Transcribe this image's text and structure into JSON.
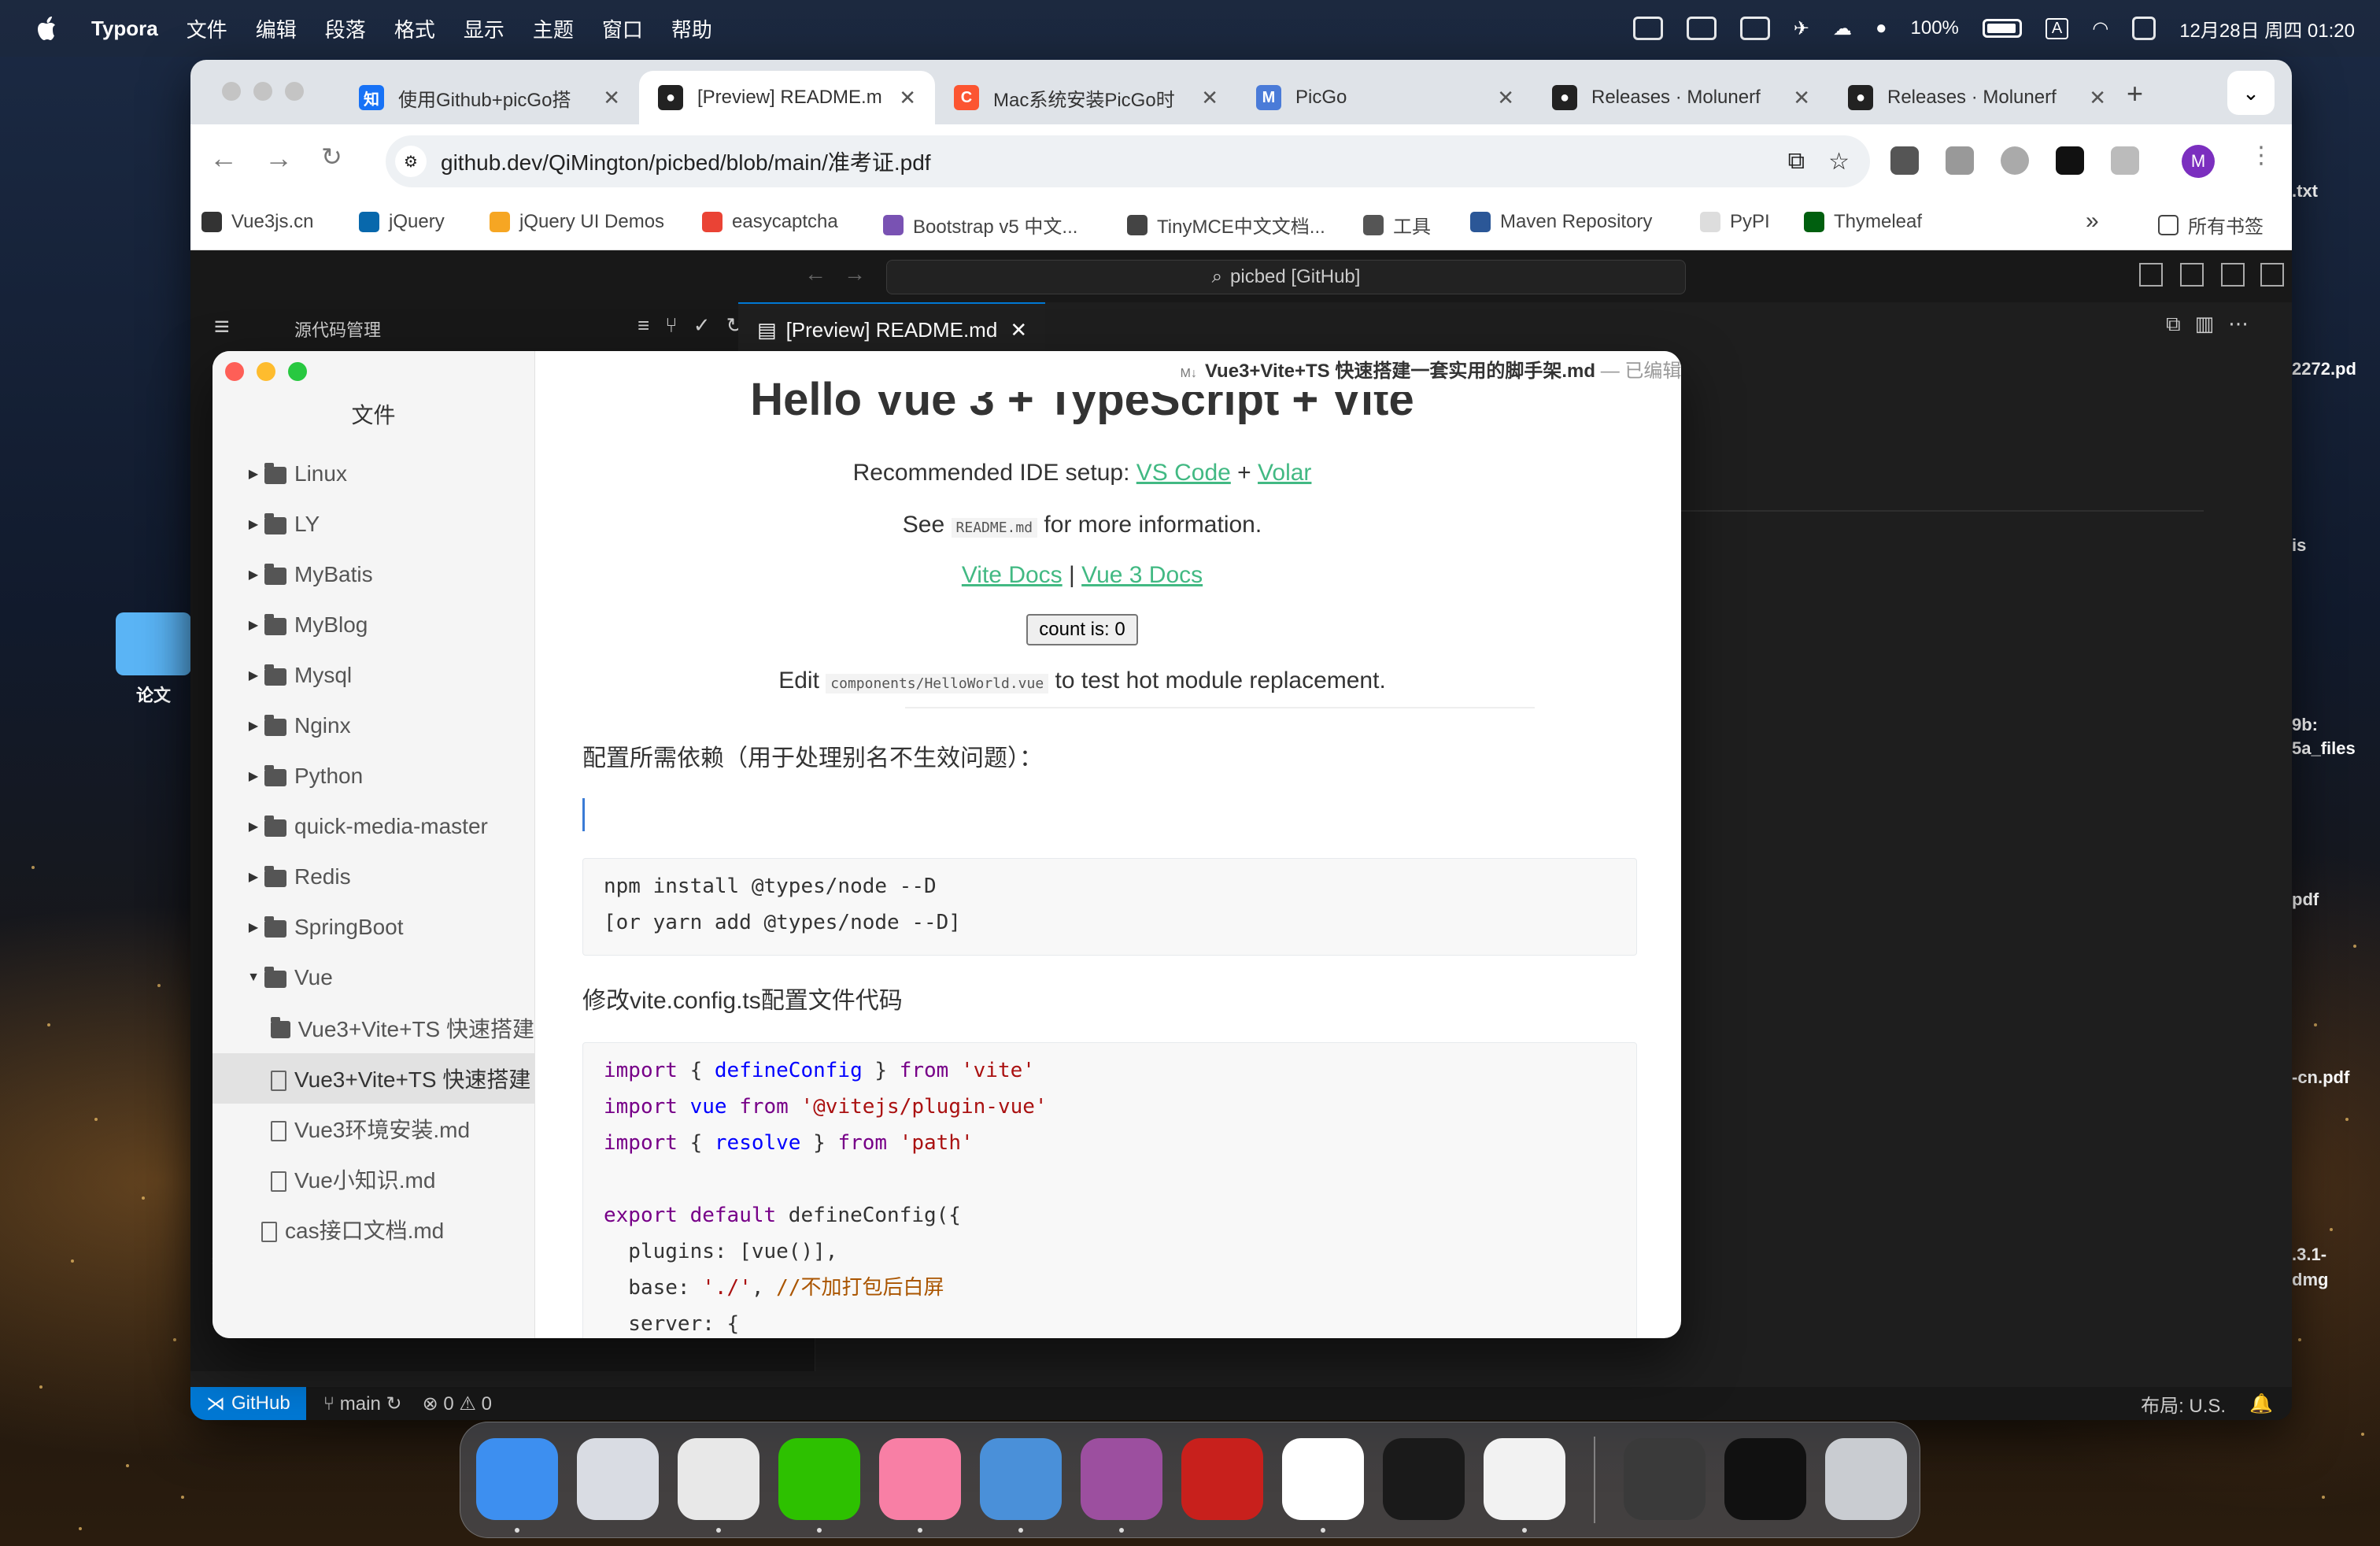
{
  "menubar": {
    "app": "Typora",
    "items": [
      "文件",
      "编辑",
      "段落",
      "格式",
      "显示",
      "主题",
      "窗口",
      "帮助"
    ],
    "battery": "100%",
    "input": "A",
    "datetime": "12月28日 周四 01:20"
  },
  "desktop": {
    "folder_label": "论文",
    "right_labels": [
      ".txt",
      "2272.pd",
      "is",
      "9b:",
      "5a_files",
      "pdf",
      "-cn.pdf",
      ".3.1-",
      "dmg"
    ]
  },
  "browser": {
    "tabs": [
      {
        "title": "使用Github+picGo搭",
        "icon": "zhihu-icon",
        "color": "#1772f6",
        "glyph": "知"
      },
      {
        "title": "[Preview] README.m",
        "icon": "github-icon",
        "color": "#222222",
        "glyph": "●"
      },
      {
        "title": "Mac系统安装PicGo时",
        "icon": "csdn-icon",
        "color": "#fc5531",
        "glyph": "C"
      },
      {
        "title": "PicGo",
        "icon": "picgo-icon",
        "color": "#4a7bd8",
        "glyph": "M"
      },
      {
        "title": "Releases · Molunerf",
        "icon": "github-icon",
        "color": "#222222",
        "glyph": "●"
      },
      {
        "title": "Releases · Molunerf",
        "icon": "github-icon",
        "color": "#222222",
        "glyph": "●"
      }
    ],
    "url": "github.dev/QiMington/picbed/blob/main/准考证.pdf",
    "profile_initial": "M",
    "bookmarks": [
      {
        "label": "Vue3js.cn",
        "color": "#333333"
      },
      {
        "label": "jQuery",
        "color": "#0868ac"
      },
      {
        "label": "jQuery UI Demos",
        "color": "#f6a623"
      },
      {
        "label": "easycaptcha",
        "color": "#ea4335"
      },
      {
        "label": "Bootstrap v5 中文...",
        "color": "#7952b3"
      },
      {
        "label": "TinyMCE中文文档...",
        "color": "#444444"
      },
      {
        "label": "工具",
        "color": "#555555"
      },
      {
        "label": "Maven Repository",
        "color": "#2b5797"
      },
      {
        "label": "PyPI",
        "color": "#dddddd"
      },
      {
        "label": "Thymeleaf",
        "color": "#005f0f"
      }
    ],
    "more": "»",
    "all_bookmarks": "所有书签"
  },
  "vscode": {
    "command_center": "picbed [GitHub]",
    "sidebar_title": "源代码管理",
    "editor_tab": "[Preview] README.md",
    "status": {
      "remote": "GitHub",
      "branch": "main",
      "problems": "0",
      "warnings": "0",
      "layout": "布局: U.S."
    }
  },
  "typora": {
    "window_title": "Vue3+Vite+TS 快速搭建一套实用的脚手架.md",
    "edited": "— 已编辑",
    "sidebar_header": "文件",
    "tree": [
      {
        "label": "Linux",
        "type": "folder",
        "level": 0,
        "expanded": false
      },
      {
        "label": "LY",
        "type": "folder",
        "level": 0,
        "expanded": false
      },
      {
        "label": "MyBatis",
        "type": "folder",
        "level": 0,
        "expanded": false
      },
      {
        "label": "MyBlog",
        "type": "folder",
        "level": 0,
        "expanded": false
      },
      {
        "label": "Mysql",
        "type": "folder",
        "level": 0,
        "expanded": false
      },
      {
        "label": "Nginx",
        "type": "folder",
        "level": 0,
        "expanded": false
      },
      {
        "label": "Python",
        "type": "folder",
        "level": 0,
        "expanded": false
      },
      {
        "label": "quick-media-master",
        "type": "folder",
        "level": 0,
        "expanded": false
      },
      {
        "label": "Redis",
        "type": "folder",
        "level": 0,
        "expanded": false
      },
      {
        "label": "SpringBoot",
        "type": "folder",
        "level": 0,
        "expanded": false
      },
      {
        "label": "Vue",
        "type": "folder",
        "level": 0,
        "expanded": true
      },
      {
        "label": "Vue3+Vite+TS 快速搭建",
        "type": "folder",
        "level": 1,
        "expanded": false
      },
      {
        "label": "Vue3+Vite+TS 快速搭建",
        "type": "file",
        "level": 1,
        "selected": true
      },
      {
        "label": "Vue3环境安装.md",
        "type": "file",
        "level": 1
      },
      {
        "label": "Vue小知识.md",
        "type": "file",
        "level": 1
      },
      {
        "label": "cas接口文档.md",
        "type": "file",
        "level": 0
      }
    ],
    "doc": {
      "h1": "Hello Vue 3 + TypeScript + Vite",
      "ide_prefix": "Recommended IDE setup:",
      "ide_link1": "VS Code",
      "ide_plus": "+",
      "ide_link2": "Volar",
      "see_prefix": "See",
      "see_code": "README.md",
      "see_suffix": "for more information.",
      "docs_link1": "Vite Docs",
      "docs_sep": "|",
      "docs_link2": "Vue 3 Docs",
      "count_button": "count is: 0",
      "edit_prefix": "Edit",
      "edit_code": "components/HelloWorld.vue",
      "edit_suffix": "to test hot module replacement.",
      "para1": "配置所需依赖（用于处理别名不生效问题）：",
      "code1": [
        "npm install @types/node --D",
        "[or yarn add @types/node --D]"
      ],
      "para2": "修改vite.config.ts配置文件代码"
    }
  },
  "dock": {
    "apps": [
      {
        "name": "finder",
        "color": "#3d8ff0"
      },
      {
        "name": "launchpad",
        "color": "#d9dce3"
      },
      {
        "name": "chrome",
        "color": "#e8e8e8"
      },
      {
        "name": "wechat",
        "color": "#2dc100"
      },
      {
        "name": "bilibili",
        "color": "#f87fa5"
      },
      {
        "name": "vscode-monitor",
        "color": "#4a90d9"
      },
      {
        "name": "centos",
        "color": "#9c4f9f"
      },
      {
        "name": "acrobat",
        "color": "#c8201c"
      },
      {
        "name": "word",
        "color": "#ffffff"
      },
      {
        "name": "terminal",
        "color": "#1a1a1a"
      },
      {
        "name": "typora",
        "color": "#f2f2f2"
      },
      {
        "name": "recent-window-1",
        "color": "#3a3a3a"
      },
      {
        "name": "recent-window-2",
        "color": "#111111"
      },
      {
        "name": "trash",
        "color": "#c9ccd1"
      }
    ]
  }
}
